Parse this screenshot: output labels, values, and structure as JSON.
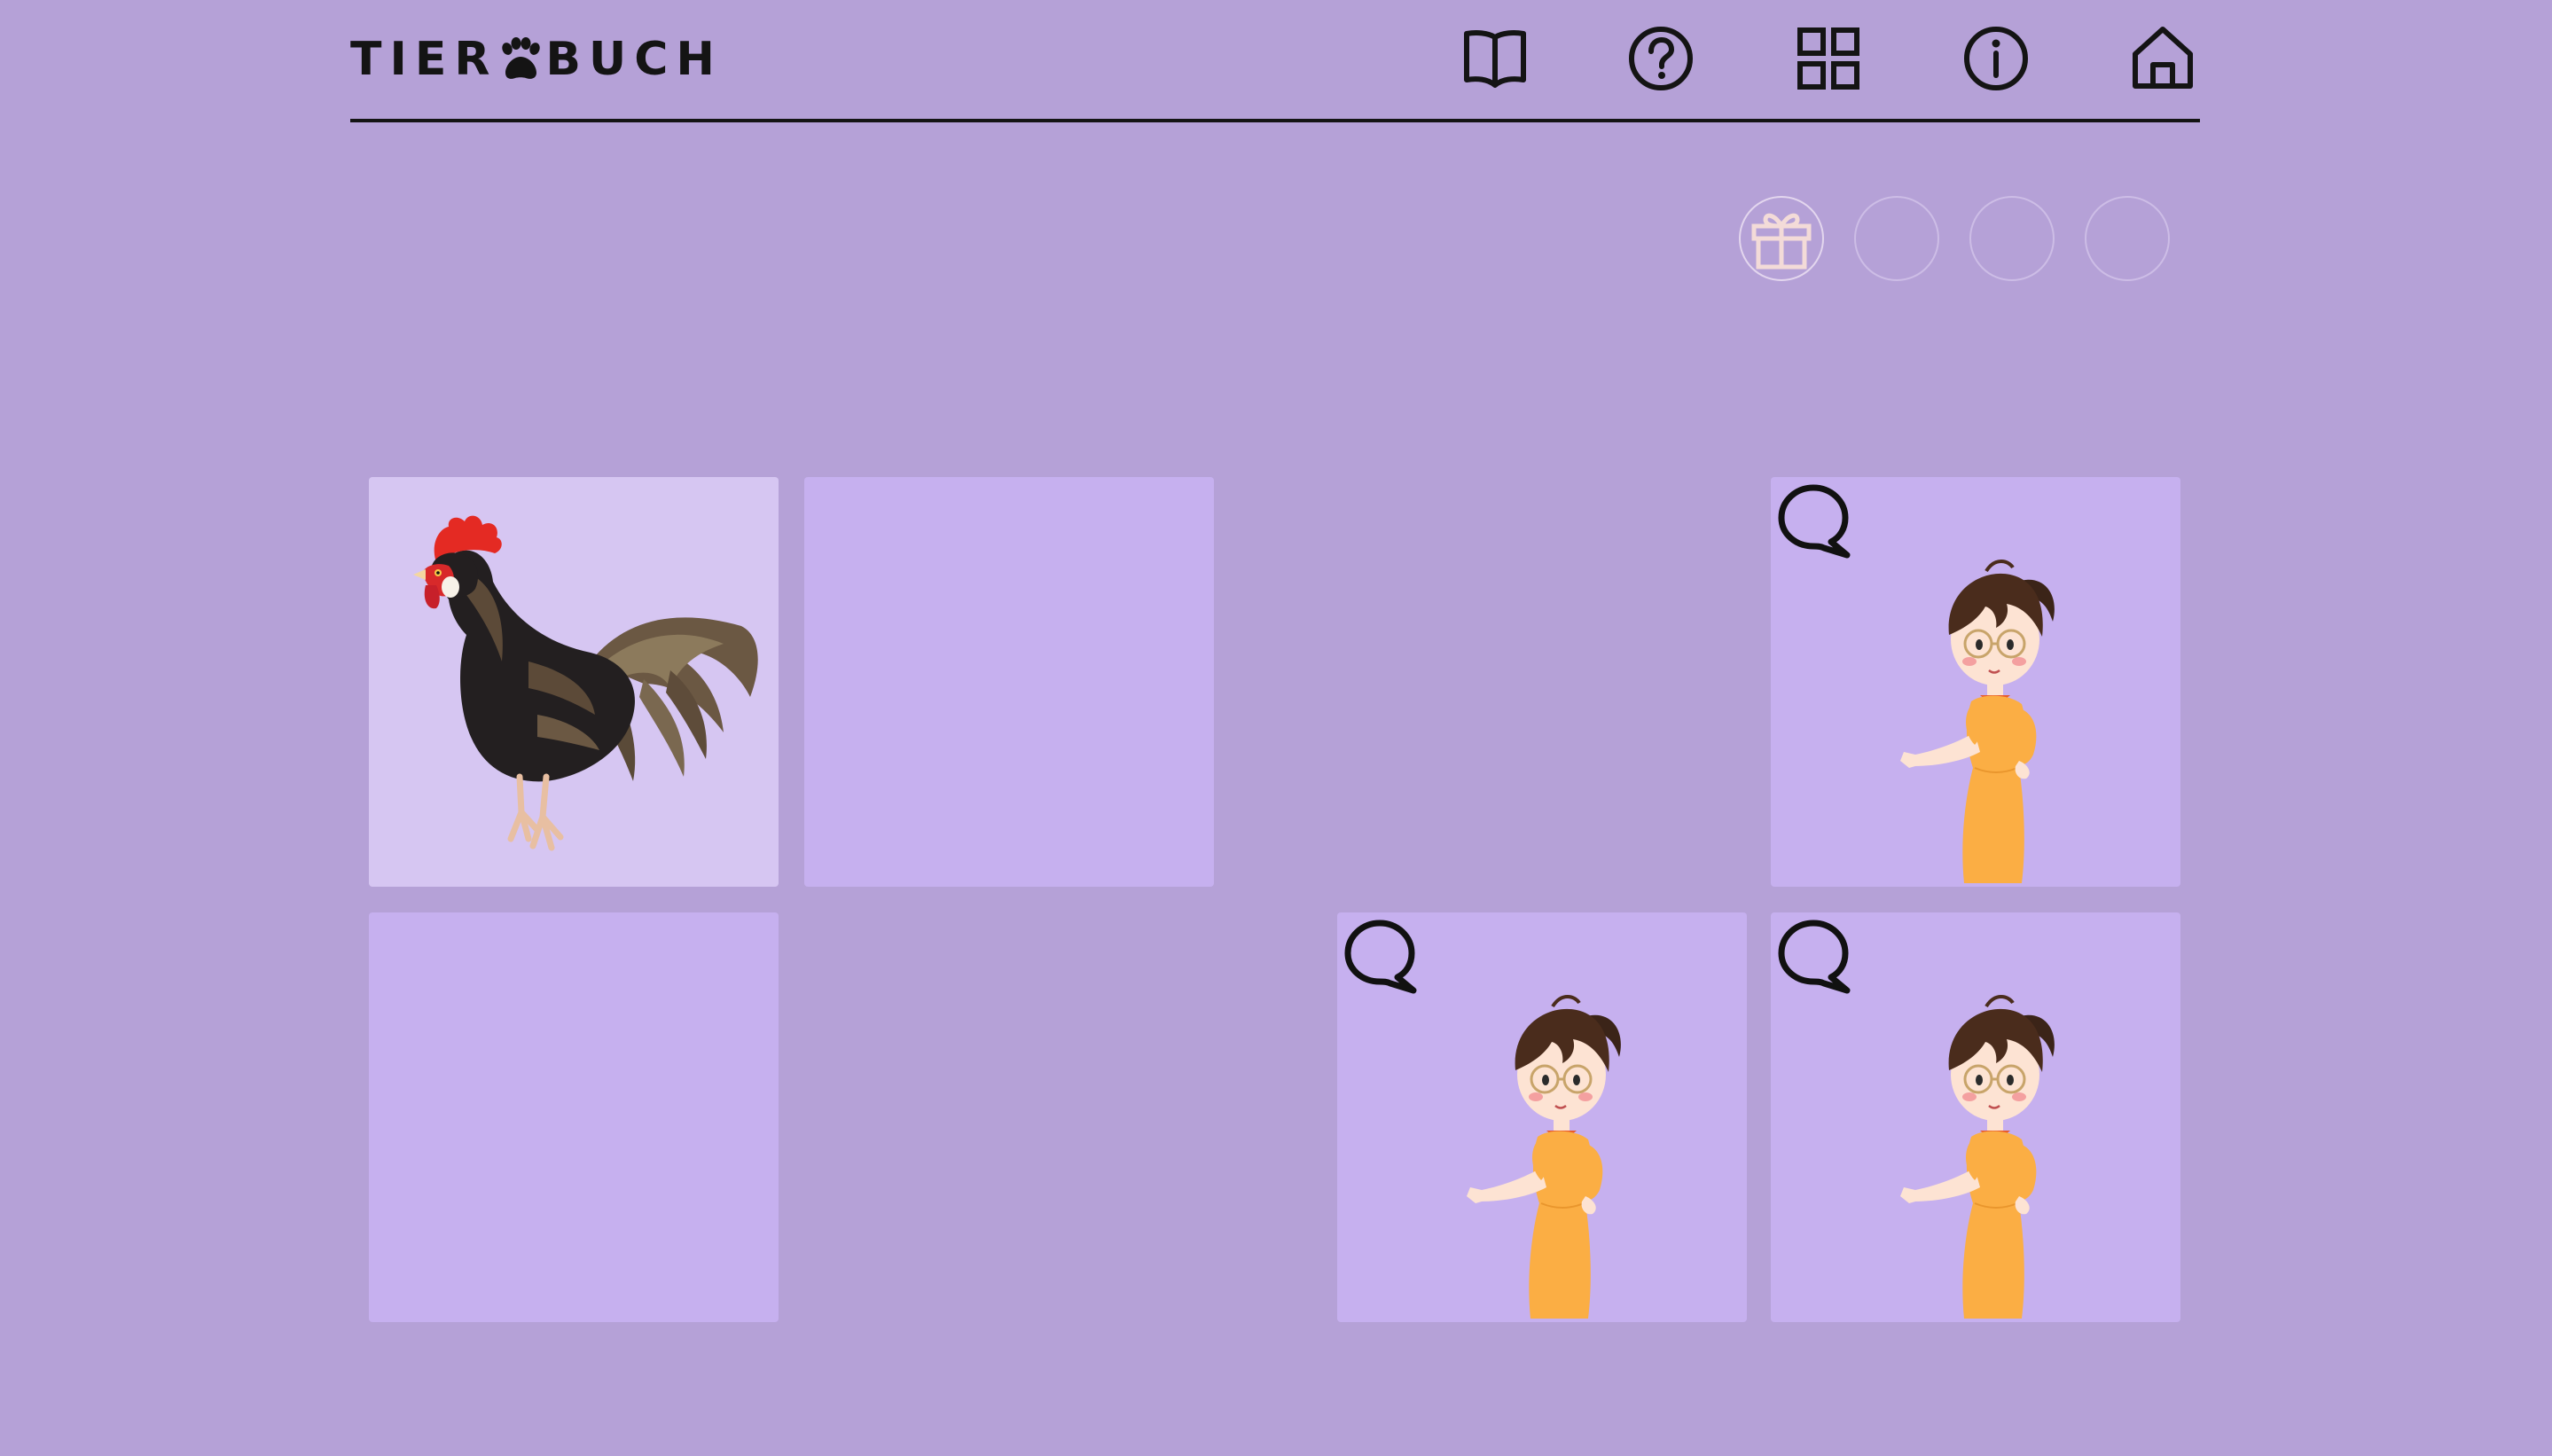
{
  "app": {
    "logo_left": "TIER",
    "logo_right": "BUCH",
    "logo_icon": "paw-icon"
  },
  "nav": {
    "icons": [
      "book-icon",
      "help-icon",
      "grid-icon",
      "info-icon",
      "home-icon"
    ]
  },
  "progress": {
    "total": 4,
    "completed": 1,
    "reward_icon": "gift-icon"
  },
  "board": {
    "cards": [
      {
        "state": "revealed",
        "content": "rooster"
      },
      {
        "state": "hidden"
      },
      {
        "state": "removed"
      },
      {
        "state": "speaker",
        "icon": "speech-bubble-icon"
      },
      {
        "state": "hidden"
      },
      {
        "state": "removed"
      },
      {
        "state": "speaker",
        "icon": "speech-bubble-icon"
      },
      {
        "state": "speaker",
        "icon": "speech-bubble-icon"
      }
    ]
  },
  "colors": {
    "background": "#b5a1d7",
    "card": "#c6b0ef",
    "card_revealed": "#d6c6f2",
    "ink": "#141414",
    "gift": "#f3dbd8"
  }
}
